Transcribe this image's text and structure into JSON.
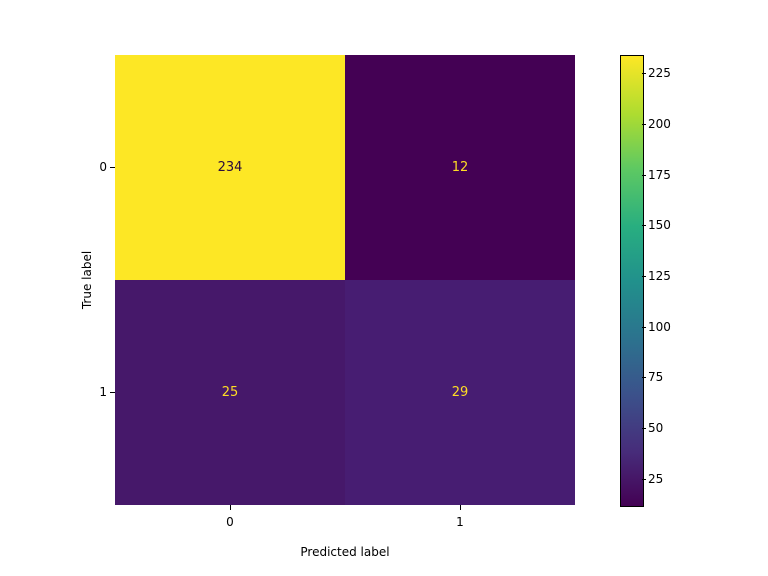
{
  "chart_data": {
    "type": "heatmap",
    "xlabel": "Predicted label",
    "ylabel": "True label",
    "x_categories": [
      "0",
      "1"
    ],
    "y_categories": [
      "0",
      "1"
    ],
    "matrix": [
      [
        234,
        12
      ],
      [
        25,
        29
      ]
    ],
    "colorbar": {
      "ticks": [
        25,
        50,
        75,
        100,
        125,
        150,
        175,
        200,
        225
      ],
      "vmin": 12,
      "vmax": 234
    },
    "cell_text_color_dark_on_light": true
  },
  "cells": {
    "c00": "234",
    "c01": "12",
    "c10": "25",
    "c11": "29"
  },
  "xticks": {
    "t0": "0",
    "t1": "1"
  },
  "yticks": {
    "t0": "0",
    "t1": "1"
  },
  "labels": {
    "x": "Predicted label",
    "y": "True label"
  },
  "cticks": {
    "t25": "25",
    "t50": "50",
    "t75": "75",
    "t100": "100",
    "t125": "125",
    "t150": "150",
    "t175": "175",
    "t200": "200",
    "t225": "225"
  },
  "colors": {
    "viridis_low": "#440154",
    "viridis_12": "#440154",
    "viridis_25": "#46186a",
    "viridis_29": "#471d72",
    "viridis_high": "#fde725"
  }
}
